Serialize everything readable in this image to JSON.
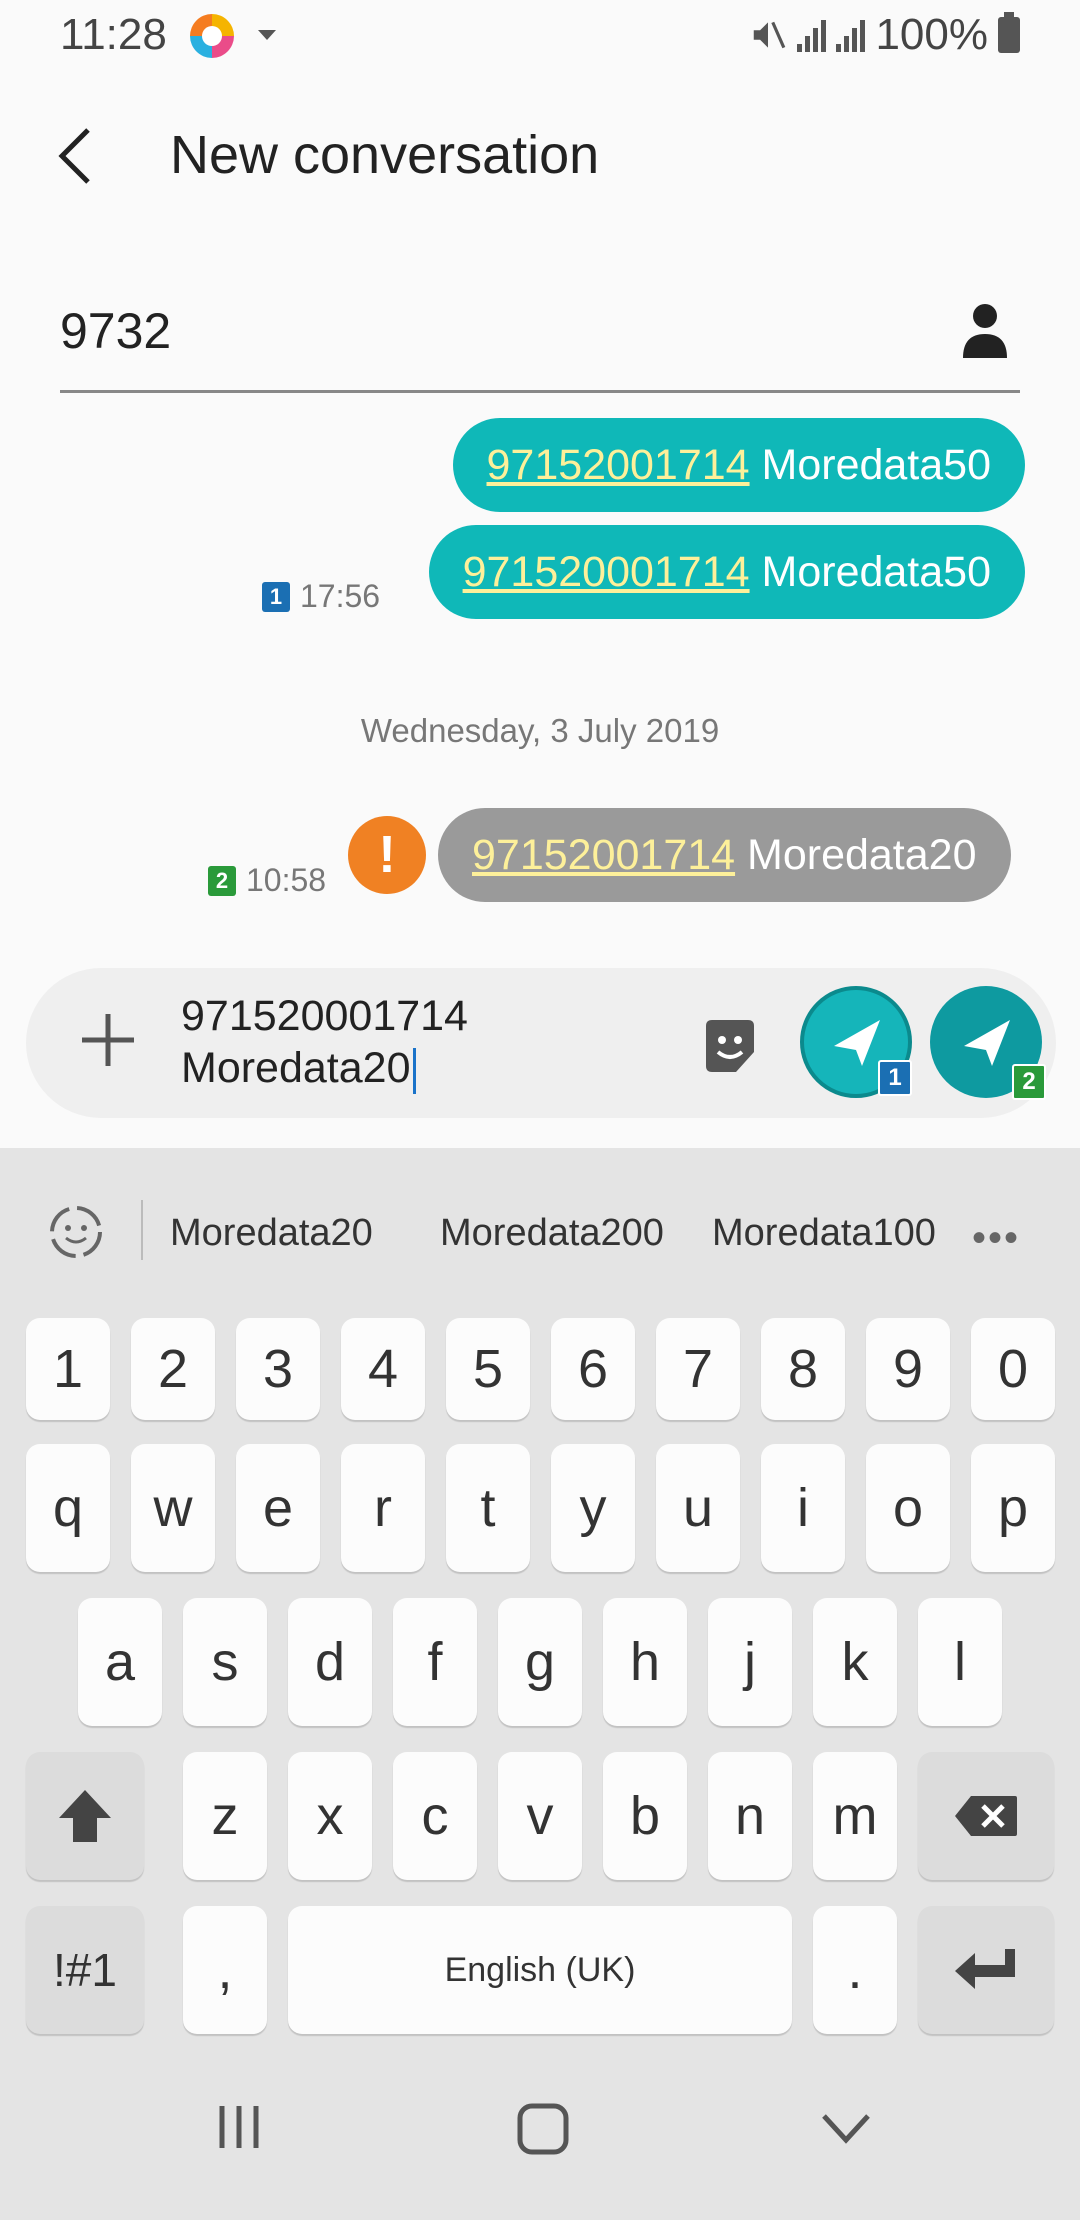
{
  "status_bar": {
    "time": "11:28",
    "battery": "100%"
  },
  "header": {
    "title": "New conversation"
  },
  "recipient": {
    "value": "9732"
  },
  "messages": [
    {
      "number": "97152001714",
      "text": " Moredata50"
    },
    {
      "number": "971520001714",
      "text": " Moredata50",
      "sim": "1",
      "time": "17:56"
    }
  ],
  "date_divider": "Wednesday, 3 July 2019",
  "failed_message": {
    "number": "97152001714",
    "text": " Moredata20",
    "sim": "2",
    "time": "10:58",
    "error": "!"
  },
  "composer": {
    "line1": "971520001714",
    "line2": "Moredata20",
    "send1_sim": "1",
    "send2_sim": "2"
  },
  "suggestions": [
    "Moredata20",
    "Moredata200",
    "Moredata100"
  ],
  "keyboard": {
    "row_numbers": [
      "1",
      "2",
      "3",
      "4",
      "5",
      "6",
      "7",
      "8",
      "9",
      "0"
    ],
    "row1": [
      "q",
      "w",
      "e",
      "r",
      "t",
      "y",
      "u",
      "i",
      "o",
      "p"
    ],
    "row2": [
      "a",
      "s",
      "d",
      "f",
      "g",
      "h",
      "j",
      "k",
      "l"
    ],
    "row3": [
      "z",
      "x",
      "c",
      "v",
      "b",
      "n",
      "m"
    ],
    "symbols": "!#1",
    "comma": ",",
    "space": "English (UK)",
    "period": "."
  },
  "colors": {
    "bubble": "#0fb8b8",
    "failed_bubble": "#9a9a9a",
    "link": "#fdf09a",
    "error": "#f08123"
  }
}
